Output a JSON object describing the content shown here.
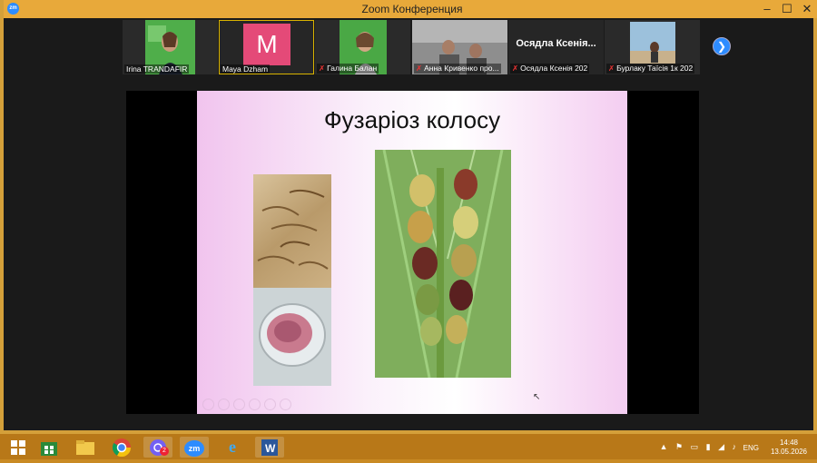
{
  "window": {
    "title": "Zoom Конференция",
    "app_icon_label": "zm"
  },
  "participants": [
    {
      "name": "Irina TRANDAFIR",
      "muted": false,
      "type": "video"
    },
    {
      "name": "Maya Dzham",
      "muted": false,
      "type": "avatar",
      "initial": "M",
      "active": true
    },
    {
      "name": "Галина Балан",
      "muted": true,
      "type": "video"
    },
    {
      "name": "Анна Кривенко про...",
      "muted": true,
      "type": "video"
    },
    {
      "name": "Осядла Ксенія 202",
      "muted": true,
      "type": "name-only",
      "display": "Осядла Ксенія..."
    },
    {
      "name": "Бурлаку Таїсія 1к 202",
      "muted": true,
      "type": "video"
    }
  ],
  "slide": {
    "title": "Фузаріоз колосу"
  },
  "taskbar": {
    "apps": [
      "start",
      "store",
      "file-explorer",
      "chrome",
      "viber",
      "zoom",
      "internet-explorer",
      "word"
    ],
    "viber_badge": "2",
    "zoom_label": "zm",
    "language": "ENG",
    "time": "14:48",
    "date": "13.05.2026"
  }
}
